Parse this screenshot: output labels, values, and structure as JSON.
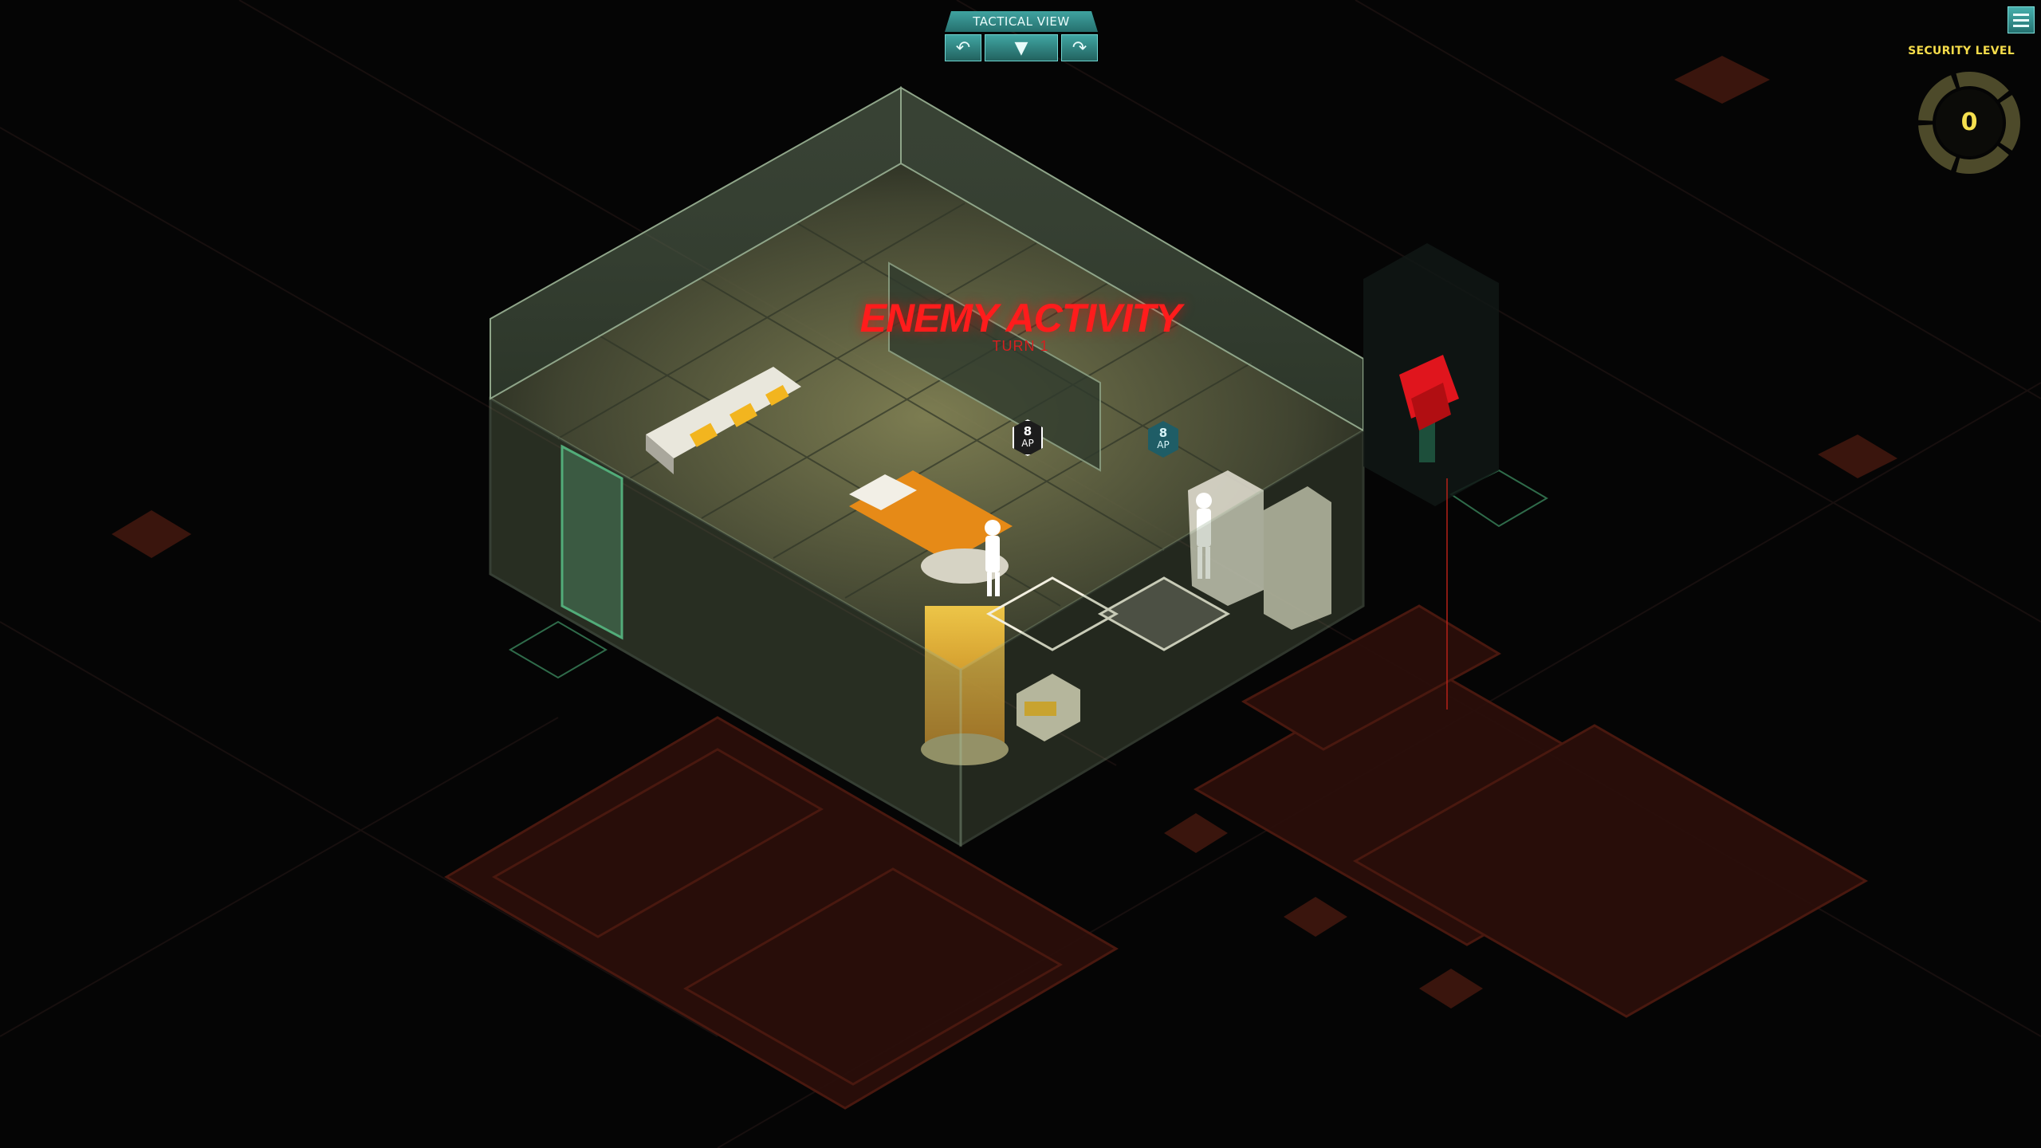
{
  "hud": {
    "tactical_view_title": "TACTICAL VIEW",
    "rotate_left_icon": "rotate-left-icon",
    "mid_icon": "chevron-down-icon",
    "rotate_right_icon": "rotate-right-icon",
    "menu_icon": "hamburger-menu-icon"
  },
  "security": {
    "label": "SECURITY LEVEL",
    "value": "0",
    "segments_total": 5,
    "segments_filled": 0
  },
  "banner": {
    "title": "ENEMY ACTIVITY",
    "subtitle": "TURN 1"
  },
  "agents": [
    {
      "ap_value": "8",
      "ap_label": "AP",
      "selected": true
    },
    {
      "ap_value": "8",
      "ap_label": "AP",
      "selected": false
    }
  ],
  "colors": {
    "accent": "#3fa3a0",
    "security_yellow": "#f5dc4a",
    "alert_red": "#ff1c1c",
    "floor_red": "#5a1c12",
    "room_glow": "#f3b320"
  }
}
